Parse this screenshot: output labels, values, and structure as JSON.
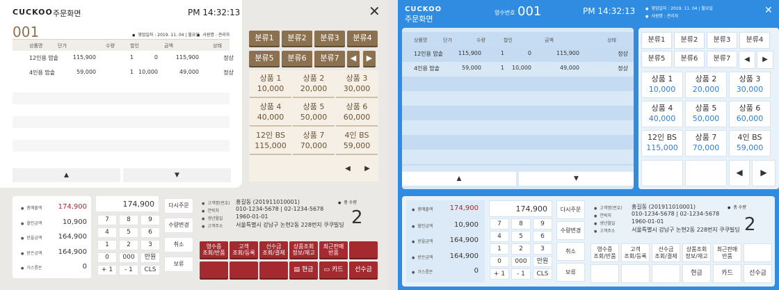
{
  "left": {
    "brand": "CUCKOO",
    "title": "주문화면",
    "time": "PM 14:32:13",
    "order_no": "001",
    "biz_date_label": "영업일자 : 2019. 11. 04 | 월요일",
    "seller_label": "사원명 : 관리자",
    "table": {
      "headers": [
        "상품명",
        "단가",
        "수량",
        "할인",
        "금액",
        "상태"
      ],
      "rows": [
        [
          "12인용 밥솥",
          "115,900",
          "1",
          "0",
          "115,900",
          "정상"
        ],
        [
          "4인용 밥솥",
          "59,000",
          "1",
          "10,000",
          "49,000",
          "정상"
        ]
      ]
    },
    "categories": [
      "분류1",
      "분류2",
      "분류3",
      "분류4",
      "분류5",
      "분류6",
      "분류7"
    ],
    "products": [
      {
        "name": "상품 1",
        "price": "10,000"
      },
      {
        "name": "상품 2",
        "price": "20,000"
      },
      {
        "name": "상품 3",
        "price": "30,000"
      },
      {
        "name": "상품 4",
        "price": "40,000"
      },
      {
        "name": "상품 5",
        "price": "50,000"
      },
      {
        "name": "상품 6",
        "price": "60,000"
      },
      {
        "name": "12인 BS",
        "price": "115,000"
      },
      {
        "name": "상품 7",
        "price": "70,000"
      },
      {
        "name": "4인 BS",
        "price": "59,000"
      }
    ],
    "summary": [
      {
        "label": "총매출액",
        "value": "174,900"
      },
      {
        "label": "할인금액",
        "value": "10,900"
      },
      {
        "label": "받을금액",
        "value": "164,900"
      },
      {
        "label": "받은금액",
        "value": "164,900"
      },
      {
        "label": "거스름돈",
        "value": "0"
      }
    ],
    "display_value": "174,900",
    "keypad": [
      "7",
      "8",
      "9",
      "4",
      "5",
      "6",
      "1",
      "2",
      "3",
      "0",
      "000",
      "만원",
      "+ 1",
      "- 1",
      "CLS"
    ],
    "actions": [
      "다시주문",
      "수량변경",
      "취소",
      "보류"
    ],
    "customer": [
      {
        "label": "고객명(번호)",
        "value": "홍길동 (201911010001)"
      },
      {
        "label": "연락처",
        "value": "010-1234-5678 | 02-1234-5678"
      },
      {
        "label": "생년월일",
        "value": "1960-01-01"
      },
      {
        "label": "고객주소",
        "value": "서울특별시 강남구 논현2동 228번지 쿠쿠빌딩"
      }
    ],
    "total_qty_label": "총 수량",
    "total_qty": "2",
    "func_buttons": [
      "영수증\n조회/반품",
      "고객\n조회/등록",
      "선수금\n조회/결제",
      "상품조회\n정보/재고",
      "최근판매\n반품"
    ],
    "pay_buttons": [
      "현금",
      "카드",
      "선수금"
    ]
  },
  "right": {
    "brand": "CUCKOO",
    "title": "주문화면",
    "receipt_label": "영수번호",
    "order_no": "001",
    "time": "PM 14:32:13",
    "biz_date_label": "영업일자 : 2019. 11. 04 | 월요일",
    "seller_label": "사원명 : 관리자",
    "table": {
      "headers": [
        "상품명",
        "단가",
        "수량",
        "할인",
        "금액",
        "상태"
      ],
      "rows": [
        [
          "12인용 밥솥",
          "115,900",
          "1",
          "0",
          "115,900",
          "정상"
        ],
        [
          "4인용 밥솥",
          "59,000",
          "1",
          "10,000",
          "49,000",
          "정상"
        ]
      ]
    },
    "categories": [
      "분류1",
      "분류2",
      "분류3",
      "분류4",
      "분류5",
      "분류6",
      "분류7"
    ],
    "products": [
      {
        "name": "상품 1",
        "price": "10,000"
      },
      {
        "name": "상품 2",
        "price": "20,000"
      },
      {
        "name": "상품 3",
        "price": "30,000"
      },
      {
        "name": "상품 4",
        "price": "40,000"
      },
      {
        "name": "상품 5",
        "price": "50,000"
      },
      {
        "name": "상품 6",
        "price": "60,000"
      },
      {
        "name": "12인 BS",
        "price": "115,000"
      },
      {
        "name": "상품 7",
        "price": "70,000"
      },
      {
        "name": "4인 BS",
        "price": "59,000"
      }
    ],
    "summary": [
      {
        "label": "총매출액",
        "value": "174,900"
      },
      {
        "label": "할인금액",
        "value": "10,900"
      },
      {
        "label": "받을금액",
        "value": "164,900"
      },
      {
        "label": "받은금액",
        "value": "164,900"
      },
      {
        "label": "거스름돈",
        "value": "0"
      }
    ],
    "display_value": "174,900",
    "keypad": [
      "7",
      "8",
      "9",
      "4",
      "5",
      "6",
      "1",
      "2",
      "3",
      "0",
      "000",
      "만원",
      "+ 1",
      "- 1",
      "CLS"
    ],
    "actions": [
      "다시주문",
      "수량변경",
      "취소",
      "보류"
    ],
    "customer": [
      {
        "label": "고객명(번호)",
        "value": "홍길동 (201911010001)"
      },
      {
        "label": "연락처",
        "value": "010-1234-5678 | 02-1234-5678"
      },
      {
        "label": "생년월일",
        "value": "1960-01-01"
      },
      {
        "label": "고객주소",
        "value": "서울특별시 강남구 논현2동 228번지 쿠쿠빌딩"
      }
    ],
    "total_qty_label": "총 수량",
    "total_qty": "2",
    "func_buttons": [
      "영수증\n조회/반품",
      "고객\n조회/등록",
      "선수금\n조회/결제",
      "상품조회\n정보/재고",
      "최근판매\n반품"
    ],
    "pay_buttons": [
      "현금",
      "카드",
      "선수금"
    ]
  },
  "colors": {
    "left_accent": "#8c7151",
    "left_red": "#a52a30",
    "right_blue": "#2f8ce0",
    "right_price": "#2b7fd8"
  }
}
